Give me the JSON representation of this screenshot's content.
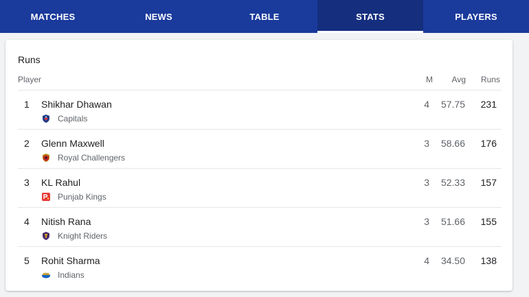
{
  "tabs": [
    {
      "label": "MATCHES",
      "active": false
    },
    {
      "label": "NEWS",
      "active": false
    },
    {
      "label": "TABLE",
      "active": false
    },
    {
      "label": "STATS",
      "active": true
    },
    {
      "label": "PLAYERS",
      "active": false
    }
  ],
  "card": {
    "title": "Runs",
    "columns": {
      "player": "Player",
      "m": "M",
      "avg": "Avg",
      "runs": "Runs"
    }
  },
  "rows": [
    {
      "rank": "1",
      "name": "Shikhar Dhawan",
      "team": "Capitals",
      "team_logo": "capitals-logo-icon",
      "m": "4",
      "avg": "57.75",
      "runs": "231"
    },
    {
      "rank": "2",
      "name": "Glenn Maxwell",
      "team": "Royal Challengers",
      "team_logo": "royal-challengers-logo-icon",
      "m": "3",
      "avg": "58.66",
      "runs": "176"
    },
    {
      "rank": "3",
      "name": "KL Rahul",
      "team": "Punjab Kings",
      "team_logo": "punjab-kings-logo-icon",
      "m": "3",
      "avg": "52.33",
      "runs": "157"
    },
    {
      "rank": "4",
      "name": "Nitish Rana",
      "team": "Knight Riders",
      "team_logo": "knight-riders-logo-icon",
      "m": "3",
      "avg": "51.66",
      "runs": "155"
    },
    {
      "rank": "5",
      "name": "Rohit Sharma",
      "team": "Indians",
      "team_logo": "indians-logo-icon",
      "m": "4",
      "avg": "34.50",
      "runs": "138"
    }
  ],
  "colors": {
    "tab_bar": "#1a3a9c",
    "tab_active": "#152e7e"
  }
}
